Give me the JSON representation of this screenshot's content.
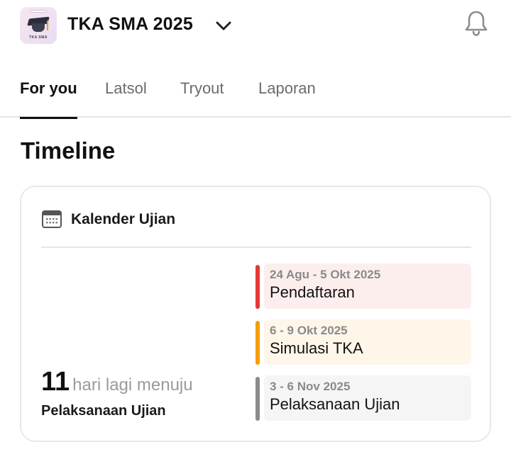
{
  "header": {
    "logo_text": "TKA SMA",
    "title": "TKA SMA 2025",
    "icons": [
      "chevron-down-icon",
      "bell-icon"
    ]
  },
  "tabs": [
    {
      "label": "For you",
      "active": true
    },
    {
      "label": "Latsol",
      "active": false
    },
    {
      "label": "Tryout",
      "active": false
    },
    {
      "label": "Laporan",
      "active": false
    }
  ],
  "section": {
    "title": "Timeline"
  },
  "calendar": {
    "icon": "calendar-icon",
    "title": "Kalender Ujian",
    "countdown": {
      "number": "11",
      "text": "hari lagi menuju",
      "target": "Pelaksanaan Ujian"
    },
    "events": [
      {
        "date": "24 Agu - 5 Okt 2025",
        "label": "Pendaftaran",
        "accent": "#e53935",
        "bg": "#fdeeee"
      },
      {
        "date": "6 - 9 Okt 2025",
        "label": "Simulasi TKA",
        "accent": "#f59e0b",
        "bg": "#fff6ea"
      },
      {
        "date": "3 - 6 Nov 2025",
        "label": "Pelaksanaan Ujian",
        "accent": "#8a8a8a",
        "bg": "#f5f5f5"
      }
    ]
  }
}
